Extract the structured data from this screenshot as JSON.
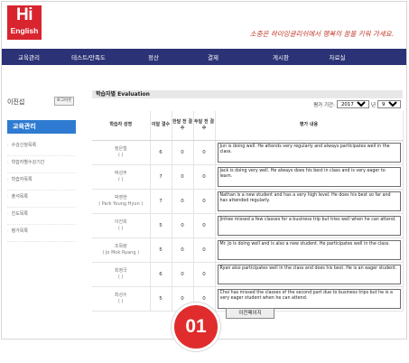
{
  "logo": {
    "line1": "Hi",
    "line2": "English"
  },
  "slogan": "소중은 하이잉글리쉬에서 행복의 꿈을 키워 가세요.",
  "topnav": [
    {
      "label": "교육관리"
    },
    {
      "label": "테스트/만족도"
    },
    {
      "label": "정산"
    },
    {
      "label": "결제"
    },
    {
      "label": "게시판"
    },
    {
      "label": "자료실"
    }
  ],
  "sidebar": {
    "user": "이진섭",
    "logout_label": "로그아웃",
    "title": "교육관리",
    "items": [
      {
        "label": "수강신청목록"
      },
      {
        "label": "학습자별수강기간"
      },
      {
        "label": "학습자목록"
      },
      {
        "label": "출석목록"
      },
      {
        "label": "진도목록"
      },
      {
        "label": "평가목록"
      }
    ]
  },
  "content": {
    "title": "학습자별 Evaluation",
    "period_label": "평가 기간:",
    "year": "2017",
    "year_suffix": "년",
    "month": "9",
    "month_suffix": "월"
  },
  "table": {
    "headers": [
      "학습자 성명",
      "이달 결수",
      "한달 전 결수",
      "두달 전 결수",
      "평가 내용"
    ],
    "rows": [
      {
        "name": "정은철",
        "sub": "(  )",
        "a": "6",
        "b": "0",
        "c": "0",
        "comment": "Jun is doing well.  He attends very regularly and always participates well in the class."
      },
      {
        "name": "박성주",
        "sub": "(  )",
        "a": "7",
        "b": "0",
        "c": "0",
        "comment": "Jack is doing very well.  He always does his best in class and is very eager to learn."
      },
      {
        "name": "박영현",
        "sub": "( Park Young Hyun )",
        "a": "7",
        "b": "0",
        "c": "0",
        "comment": "Nathan is a new student and has a very high level.  He does his best so far and has attended regularly."
      },
      {
        "name": "이진희",
        "sub": "(  )",
        "a": "5",
        "b": "0",
        "c": "0",
        "comment": "Jinhee missed a few classes for  a business trip but tries well when he can attend."
      },
      {
        "name": "조목량",
        "sub": "( Jo Mok Ryang )",
        "a": "5",
        "b": "0",
        "c": "0",
        "comment": "Mr. Jo is doing well and is also a new student.  He participates well in the class."
      },
      {
        "name": "최영국",
        "sub": "(  )",
        "a": "6",
        "b": "0",
        "c": "0",
        "comment": "Ryan also participates well in the class and does his best.  He is an eager student."
      },
      {
        "name": "최성수",
        "sub": "(  )",
        "a": "5",
        "b": "0",
        "c": "0",
        "comment": "Choi has missed the classes of the second part due to business trips but he is a very eager student when he can attend."
      }
    ]
  },
  "prev_button_label": "이전페이지",
  "step_badge": "01",
  "colors": {
    "brand_red": "#d8252f",
    "nav_navy": "#2b3275",
    "sidebar_blue": "#2e7bd1"
  }
}
